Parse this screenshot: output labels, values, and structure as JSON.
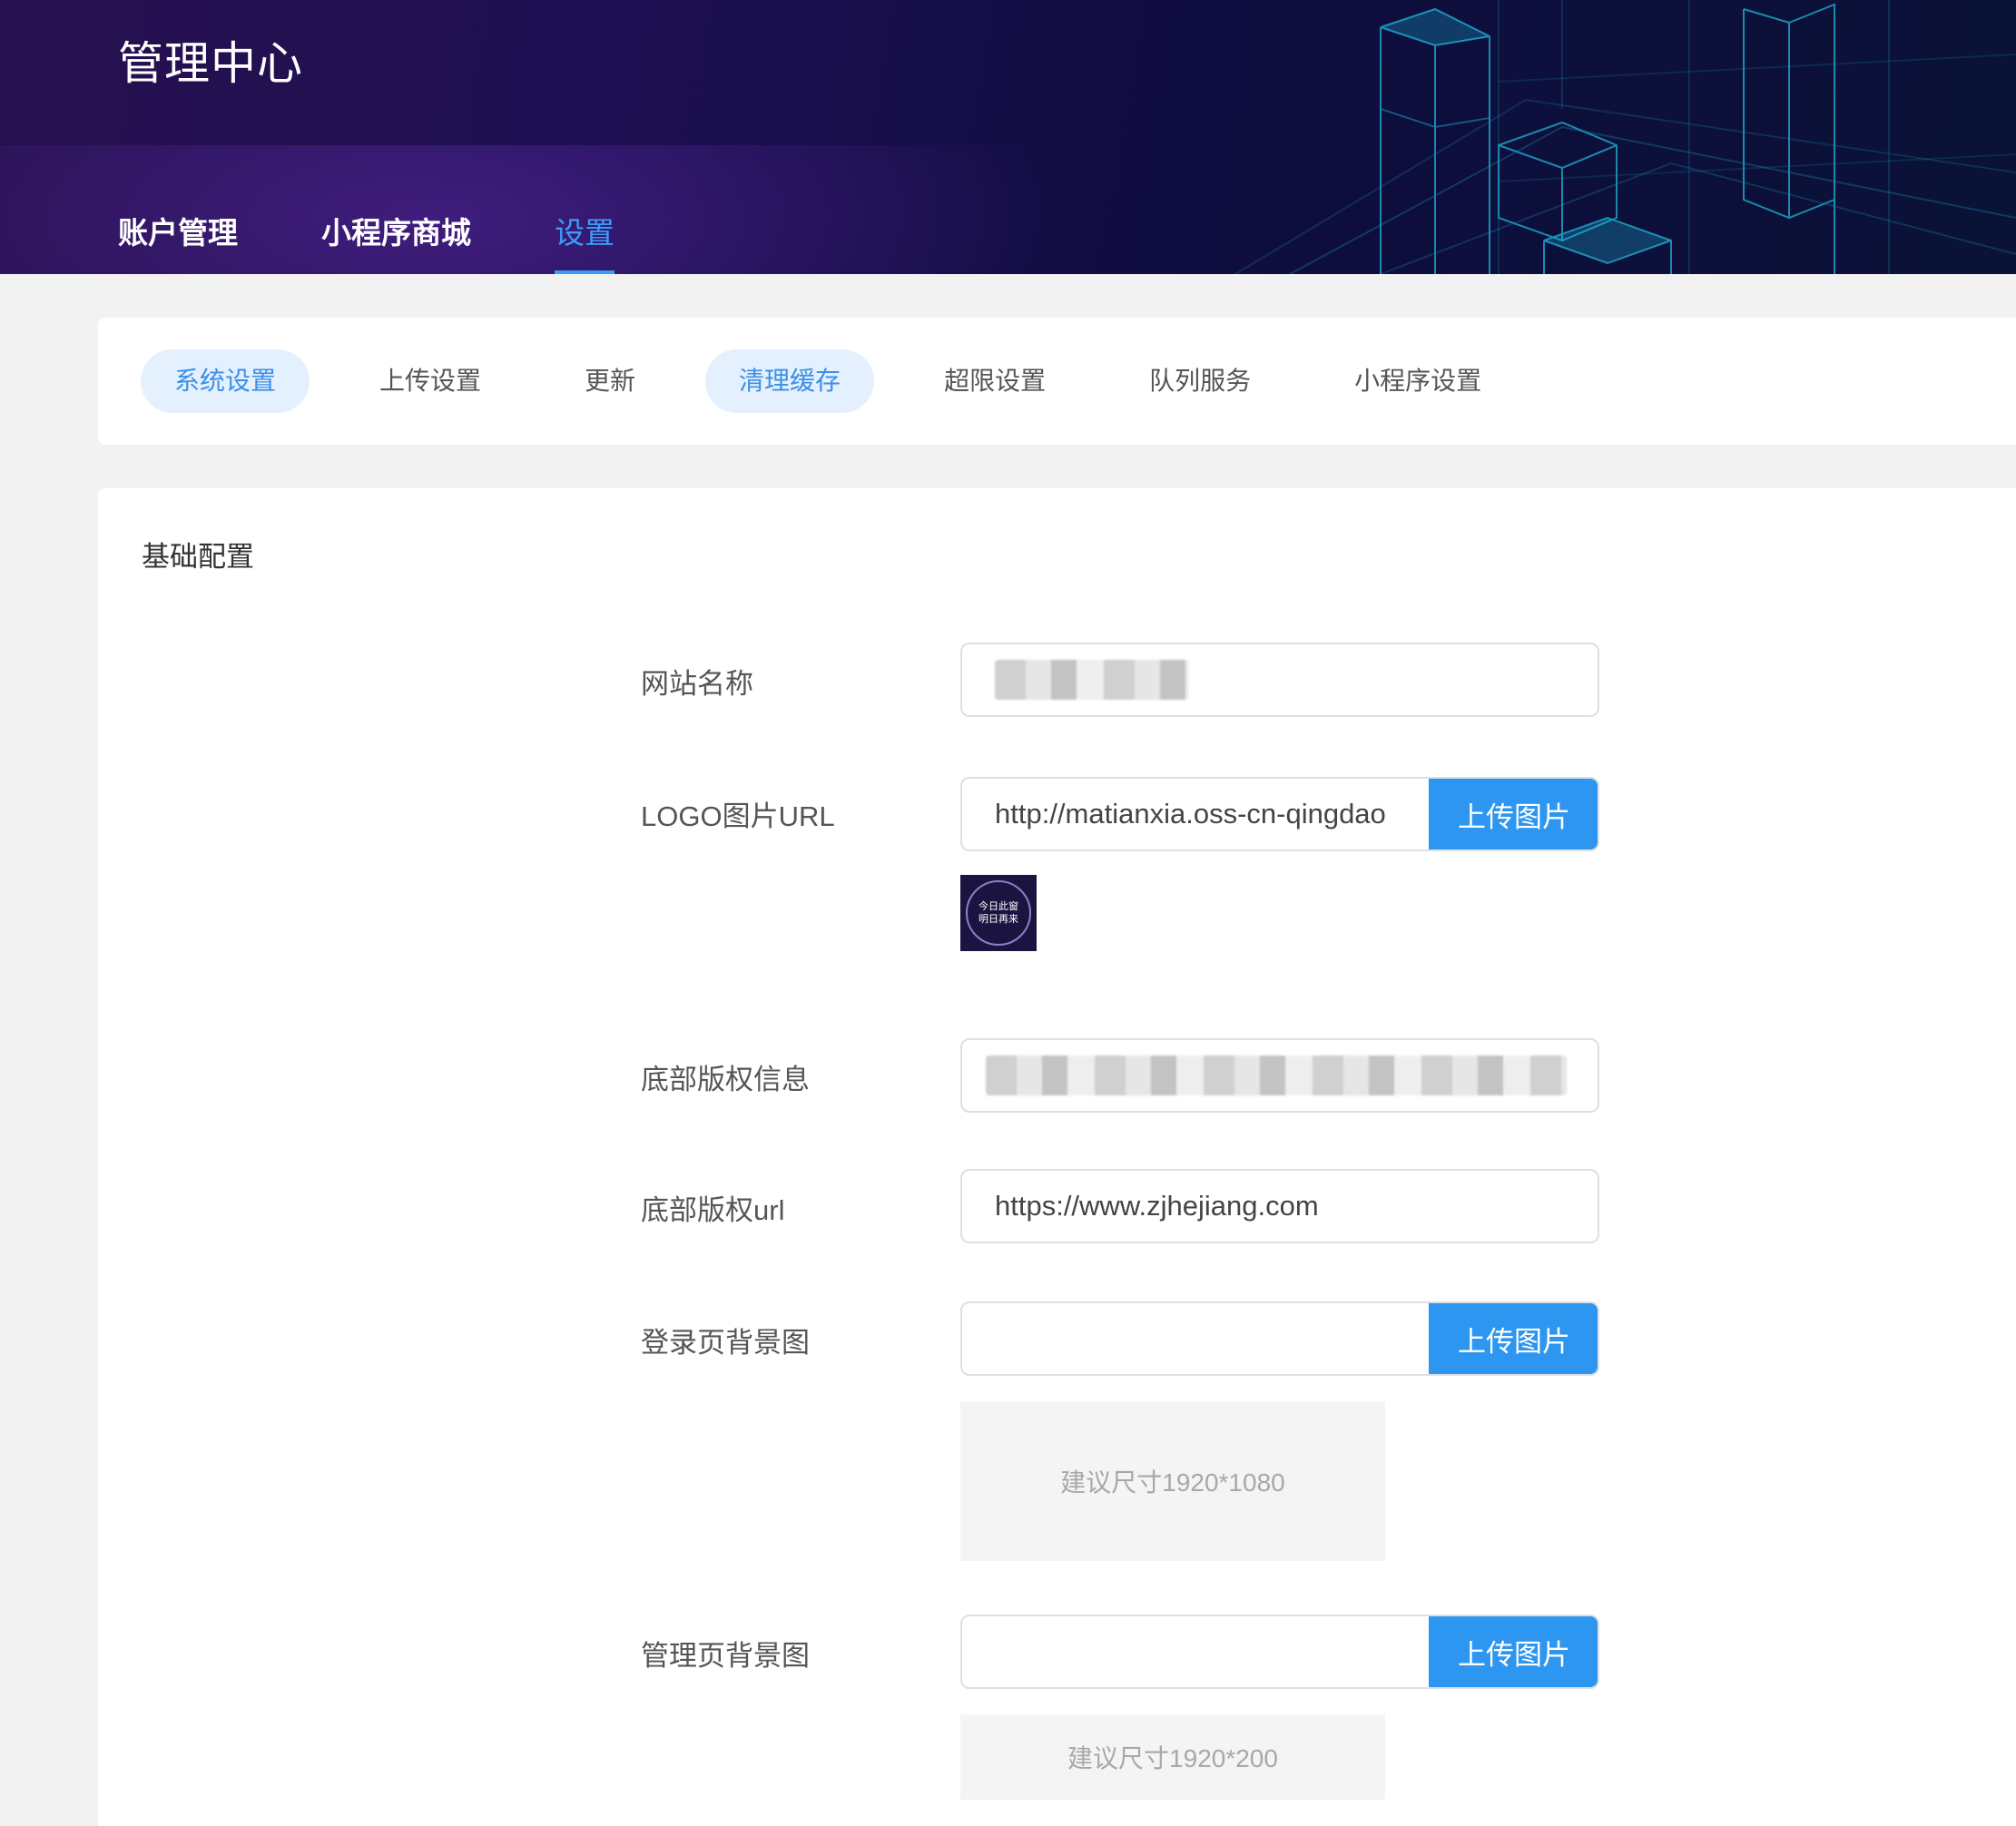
{
  "app": {
    "title": "管理中心"
  },
  "topnav": [
    {
      "label": "账户管理",
      "active": false
    },
    {
      "label": "小程序商城",
      "active": false
    },
    {
      "label": "设置",
      "active": true
    }
  ],
  "subtabs": [
    {
      "label": "系统设置",
      "active": true
    },
    {
      "label": "上传设置",
      "active": false
    },
    {
      "label": "更新",
      "active": false
    },
    {
      "label": "清理缓存",
      "active": true
    },
    {
      "label": "超限设置",
      "active": false
    },
    {
      "label": "队列服务",
      "active": false
    },
    {
      "label": "小程序设置",
      "active": false
    }
  ],
  "section": {
    "title": "基础配置"
  },
  "form": {
    "site_name": {
      "label": "网站名称",
      "value": ""
    },
    "logo_url": {
      "label": "LOGO图片URL",
      "value": "http://matianxia.oss-cn-qingdao",
      "upload_label": "上传图片",
      "thumb_text_1": "今日此窗",
      "thumb_text_2": "明日再来"
    },
    "copyright": {
      "label": "底部版权信息",
      "value": ""
    },
    "copyright_url": {
      "label": "底部版权url",
      "value": "https://www.zjhejiang.com"
    },
    "login_bg": {
      "label": "登录页背景图",
      "value": "",
      "upload_label": "上传图片",
      "hint": "建议尺寸1920*1080"
    },
    "admin_bg": {
      "label": "管理页背景图",
      "value": "",
      "upload_label": "上传图片",
      "hint": "建议尺寸1920*200"
    }
  },
  "colors": {
    "header_bg": "#1d0f52",
    "accent": "#3b9cf6",
    "button": "#2d96f0",
    "tab_active_bg": "#e4f0fd"
  }
}
